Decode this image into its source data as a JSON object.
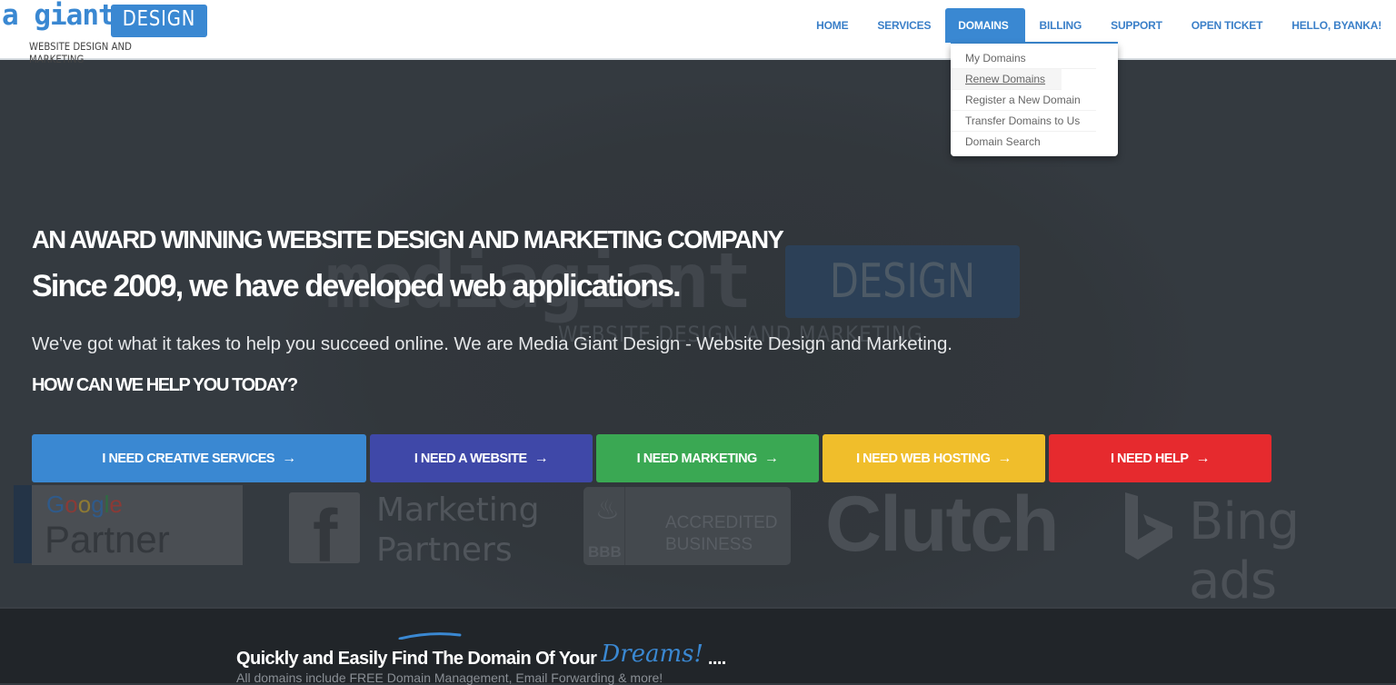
{
  "logo": {
    "brand_left": "a giant",
    "brand_box": "DESIGN",
    "tagline": "WEBSITE DESIGN AND MARKETING"
  },
  "nav": {
    "items": [
      {
        "label": "HOME"
      },
      {
        "label": "SERVICES"
      },
      {
        "label": "DOMAINS",
        "active": true
      },
      {
        "label": "BILLING"
      },
      {
        "label": "SUPPORT"
      },
      {
        "label": "OPEN TICKET"
      },
      {
        "label": "HELLO, BYANKA!"
      }
    ],
    "accent_color": "#3a88d2"
  },
  "domains_dropdown": {
    "items": [
      {
        "label": "My Domains"
      },
      {
        "label": "Renew Domains",
        "hovered": true
      },
      {
        "label": "Register a New Domain"
      },
      {
        "label": "Transfer Domains to Us"
      },
      {
        "label": "Domain Search"
      }
    ]
  },
  "hero": {
    "watermark": {
      "media": "mediagiant",
      "design": "DESIGN",
      "tagline": "WEBSITE DESIGN AND MARKETING"
    },
    "headline": "AN AWARD WINNING WEBSITE DESIGN AND MARKETING COMPANY",
    "subheadline": "Since 2009, we have developed web applications.",
    "paragraph": "We've got what it takes to help you succeed online. We are Media Giant Design - Website Design and Marketing.",
    "question": "HOW CAN WE HELP YOU TODAY?",
    "cta_buttons": [
      {
        "label": "I NEED CREATIVE SERVICES",
        "icon": "arrow-right-icon",
        "color": "#3a88d2"
      },
      {
        "label": "I NEED A WEBSITE",
        "icon": "arrow-right-icon",
        "color": "#3f48a8"
      },
      {
        "label": "I NEED MARKETING",
        "icon": "arrow-right-icon",
        "color": "#3aa853"
      },
      {
        "label": "I NEED WEB HOSTING",
        "icon": "arrow-right-icon",
        "color": "#f0be2b"
      },
      {
        "label": "I NEED HELP",
        "icon": "arrow-right-icon",
        "color": "#e62a2e"
      }
    ],
    "arrow_glyph": "→"
  },
  "partners": {
    "google": {
      "word": "Google",
      "label": "Partner"
    },
    "facebook": {
      "glyph": "f",
      "line1": "Marketing",
      "line2": "Partners"
    },
    "bbb": {
      "label": "BBB",
      "line1": "ACCREDITED",
      "line2": "BUSINESS"
    },
    "clutch": {
      "label": "Clutch"
    },
    "bing": {
      "label": "Bing ads"
    }
  },
  "domain_section": {
    "title_prefix": "Quickly and Easily Find The Domain Of Your",
    "title_highlight": "Dreams!",
    "title_suffix": "....",
    "subtitle": "All domains include FREE Domain Management, Email Forwarding & more!"
  }
}
